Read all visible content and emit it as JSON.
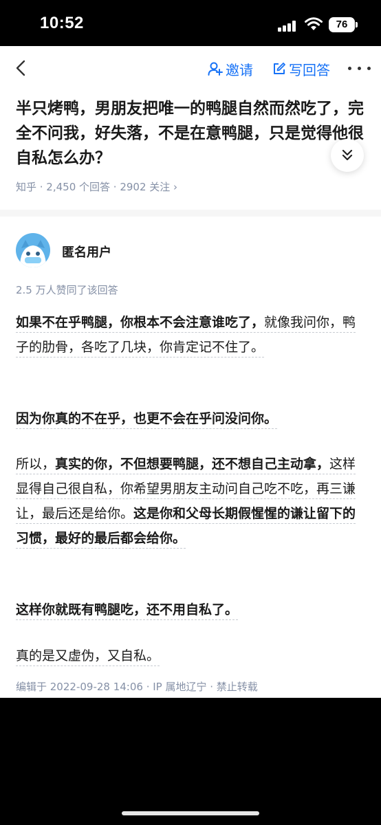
{
  "status_bar": {
    "time": "10:52",
    "battery": "76"
  },
  "nav": {
    "invite_label": "邀请",
    "write_label": "写回答"
  },
  "question": {
    "title": "半只烤鸭，男朋友把唯一的鸭腿自然而然吃了，完全不问我，好失落，不是在意鸭腿，只是觉得他很自私怎么办？",
    "meta": "知乎 · 2,450 个回答 · 2902 关注 ›"
  },
  "answer": {
    "author": "匿名用户",
    "votes": "2.5 万人赞同了该回答",
    "p1_bold": "如果不在乎鸭腿，你根本不会注意谁吃了，",
    "p1_rest": "就像我问你，鸭子的肋骨，各吃了几块，你肯定记不住了。",
    "p2": "因为你真的不在乎，也更不会在乎问没问你。",
    "p3_a": "所以，",
    "p3_b": "真实的你，不但想要鸭腿，还不想自己主动拿，",
    "p3_c": "这样显得自己很自私，你希望男朋友主动问自己吃不吃，再三谦让，最后还是给你。",
    "p3_d": "这是你和父母长期假惺惺的谦让留下的习惯，最好的最后都会给你。",
    "p4": "这样你就既有鸭腿吃，还不用自私了。",
    "p5": "真的是又虚伪，又自私。",
    "edit_info": "编辑于 2022-09-28 14:06 · IP 属地辽宁 · 禁止转载"
  },
  "colors": {
    "accent": "#1772f6",
    "meta": "#8590a6",
    "avatar_bg": "#5fb3ea"
  }
}
